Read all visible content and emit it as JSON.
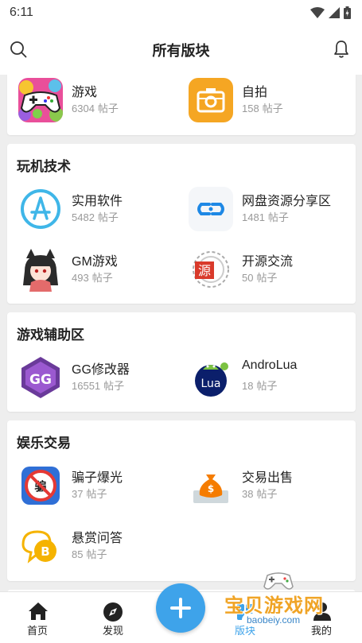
{
  "status": {
    "time": "6:11"
  },
  "header": {
    "title": "所有版块"
  },
  "sections": [
    {
      "title": "",
      "items": [
        {
          "name": "游戏",
          "count": "6304",
          "icon": "game-controller-icon"
        },
        {
          "name": "自拍",
          "count": "158",
          "icon": "camera-icon"
        }
      ]
    },
    {
      "title": "玩机技术",
      "items": [
        {
          "name": "实用软件",
          "count": "5482",
          "icon": "app-store-icon"
        },
        {
          "name": "网盘资源分享区",
          "count": "1481",
          "icon": "cloud-link-icon"
        },
        {
          "name": "GM游戏",
          "count": "493",
          "icon": "anime-girl-icon"
        },
        {
          "name": "开源交流",
          "count": "50",
          "icon": "open-source-icon"
        }
      ]
    },
    {
      "title": "游戏辅助区",
      "items": [
        {
          "name": "GG修改器",
          "count": "16551",
          "icon": "gg-logo-icon"
        },
        {
          "name": "AndroLua",
          "count": "18",
          "icon": "lua-logo-icon"
        }
      ]
    },
    {
      "title": "娱乐交易",
      "items": [
        {
          "name": "骗子爆光",
          "count": "37",
          "icon": "no-scam-icon"
        },
        {
          "name": "交易出售",
          "count": "38",
          "icon": "money-bag-icon"
        },
        {
          "name": "悬赏问答",
          "count": "85",
          "icon": "bitcoin-chat-icon"
        }
      ]
    }
  ],
  "post_unit": "帖子",
  "tabs": [
    {
      "label": "首页",
      "icon": "home-icon"
    },
    {
      "label": "发现",
      "icon": "compass-icon"
    },
    {
      "label": "版块",
      "icon": "boards-icon"
    },
    {
      "label": "我的",
      "icon": "profile-icon"
    }
  ],
  "fab": {
    "icon": "plus-icon"
  },
  "watermark": {
    "title": "宝贝游戏网",
    "url": "baobeiy.com"
  },
  "colors": {
    "accent": "#3ea3ea",
    "watermark": "#f0a426"
  }
}
